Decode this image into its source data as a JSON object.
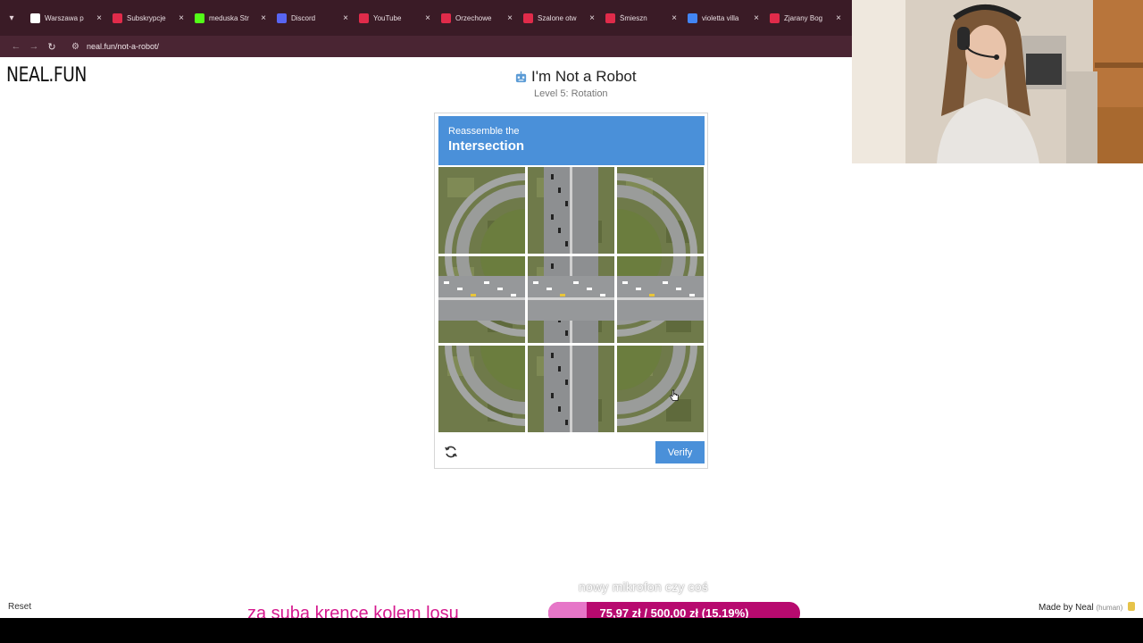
{
  "browser": {
    "tabs": [
      {
        "title": "Warszawa p",
        "color": "#ffffff"
      },
      {
        "title": "Subskrypcje",
        "color": "#e02b4a"
      },
      {
        "title": "meduska Str",
        "color": "#53fc18"
      },
      {
        "title": "Discord",
        "color": "#5865f2"
      },
      {
        "title": "YouTube",
        "color": "#e02b4a"
      },
      {
        "title": "Orzechowe",
        "color": "#e02b4a"
      },
      {
        "title": "Szalone otw",
        "color": "#e02b4a"
      },
      {
        "title": "Śmieszn",
        "color": "#e02b4a"
      },
      {
        "title": "violetta villa",
        "color": "#4285f4"
      },
      {
        "title": "Zjarany Bog",
        "color": "#e02b4a"
      }
    ],
    "url": "neal.fun/not-a-robot/",
    "back_icon": "back-arrow-icon",
    "forward_icon": "forward-arrow-icon",
    "reload_icon": "reload-icon"
  },
  "page": {
    "logo": "NEAL.FUN",
    "title": "I'm Not a Robot",
    "level": "Level 5: Rotation",
    "captcha": {
      "line1": "Reassemble the",
      "line2": "Intersection",
      "verify_label": "Verify",
      "header_color": "#4a90d9"
    },
    "reset_label": "Reset",
    "made_by": "Made by Neal",
    "made_by_tag": "(human)"
  },
  "overlay": {
    "stream_text": "za suba krence kolem losu",
    "goal_hint": "nowy mikrofon czy coś",
    "goal_text": "75,97 zł / 500,00 zł (15.19%)",
    "goal_fraction": 0.1519
  }
}
